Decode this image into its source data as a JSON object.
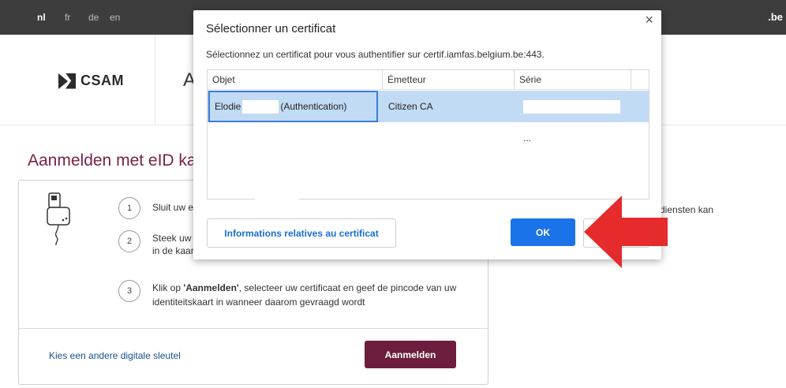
{
  "topbar": {
    "languages": [
      "nl",
      "fr",
      "de",
      "en"
    ],
    "active_language": "nl",
    "brand": ".be"
  },
  "header": {
    "logo_text": "CSAM",
    "title_fragment": "A"
  },
  "main": {
    "heading": "Aanmelden met eID ka",
    "steps": [
      {
        "number": "1",
        "text": "Sluit uw e"
      },
      {
        "number": "2",
        "line1": "Steek uw",
        "line2": "in de kaar"
      },
      {
        "number": "3",
        "line1_prefix": "Klik op ",
        "line1_bold": "'Aanmelden'",
        "line1_suffix": ", selecteer uw certificaat en geef de pincode van uw",
        "line2": "identiteitskaart in wanneer daarom gevraagd wordt"
      }
    ],
    "other_key_link": "Kies een andere digitale sleutel",
    "login_button": "Aanmelden",
    "right_text": "diensten kan"
  },
  "dialog": {
    "close_glyph": "×",
    "title": "Sélectionner un certificat",
    "description": "Sélectionnez un certificat pour vous authentifier sur certif.iamfas.belgium.be:443.",
    "columns": [
      "Objet",
      "Émetteur",
      "Série"
    ],
    "rows": [
      {
        "object_name": "Elodie",
        "object_suffix": "(Authentication)",
        "issuer": "Citizen CA",
        "serial_suffix": "..."
      }
    ],
    "info_button": "Informations relatives au certificat",
    "ok_button": "OK"
  },
  "colors": {
    "accent_red": "#e52b2b",
    "ok_blue": "#1a73e8",
    "brand_maroon": "#6d1d3d",
    "selected_row": "#c2dbf5"
  }
}
